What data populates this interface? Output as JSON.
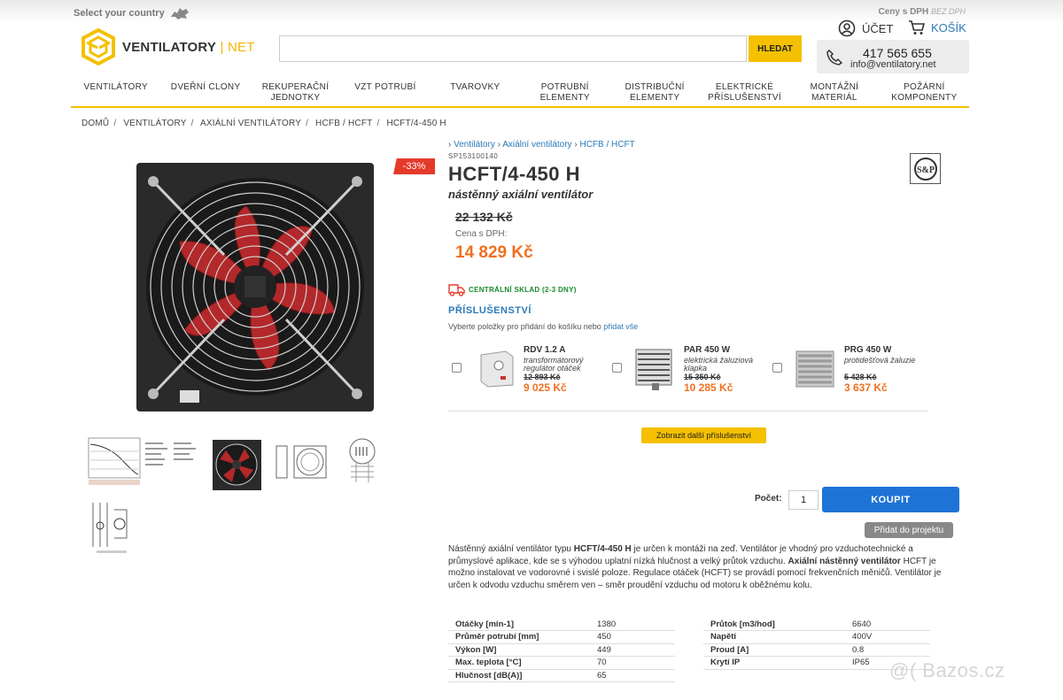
{
  "topbar": {
    "country": "Select your country",
    "vat_label": "Ceny s DPH",
    "vat_alt": "BEZ DPH"
  },
  "logo": {
    "name": "VENTILATORY",
    "suffix": "NET"
  },
  "search": {
    "placeholder": "",
    "button": "HLEDAT"
  },
  "account": {
    "label": "ÚČET"
  },
  "cart": {
    "label": "KOŠÍK"
  },
  "contact": {
    "phone": "417 565 655",
    "email": "info@ventilatory.net"
  },
  "nav": [
    {
      "l1": "VENTILÁTORY",
      "l2": ""
    },
    {
      "l1": "DVEŘNÍ CLONY",
      "l2": ""
    },
    {
      "l1": "REKUPERAČNÍ",
      "l2": "JEDNOTKY"
    },
    {
      "l1": "VZT POTRUBÍ",
      "l2": ""
    },
    {
      "l1": "TVAROVKY",
      "l2": ""
    },
    {
      "l1": "POTRUBNÍ",
      "l2": "ELEMENTY"
    },
    {
      "l1": "DISTRIBUČNÍ",
      "l2": "ELEMENTY"
    },
    {
      "l1": "ELEKTRICKÉ",
      "l2": "PŘÍSLUŠENSTVÍ"
    },
    {
      "l1": "MONTÁŽNÍ",
      "l2": "MATERIÁL"
    },
    {
      "l1": "POŽÁRNÍ",
      "l2": "KOMPONENTY"
    }
  ],
  "breadcrumb": [
    "DOMŮ",
    "VENTILÁTORY",
    "AXIÁLNÍ VENTILÁTORY",
    "HCFB / HCFT",
    "HCFT/4-450 H"
  ],
  "product": {
    "crumb": [
      "Ventilátory",
      "Axiální ventilátory",
      "HCFB / HCFT"
    ],
    "sku": "SP153100140",
    "title": "HCFT/4-450 H",
    "subtitle": "nástěnný axiální ventilátor",
    "discount": "-33%",
    "old_price": "22 132 Kč",
    "price_label": "Cena s DPH:",
    "price": "14 829 Kč",
    "stock": "CENTRÁLNÍ SKLAD (2-3 DNY)"
  },
  "accessories": {
    "title": "PŘÍSLUŠENSTVÍ",
    "note": "Vyberte položky pro přidání do košíku nebo ",
    "note_link": "přidat vše",
    "items": [
      {
        "name": "RDV 1.2 A",
        "desc1": "transformátorový",
        "desc2": "regulátor otáček",
        "old": "12 893 Kč",
        "price": "9 025 Kč"
      },
      {
        "name": "PAR 450 W",
        "desc1": "elektrická žaluziová",
        "desc2": "klapka",
        "old": "15 350 Kč",
        "price": "10 285 Kč"
      },
      {
        "name": "PRG 450 W",
        "desc1": "protidešťová žaluzie",
        "desc2": "",
        "old": "5 428 Kč",
        "price": "3 637 Kč"
      }
    ],
    "more": "Zobrazit další příslušenství"
  },
  "buy": {
    "qty_label": "Počet:",
    "qty": "1",
    "button": "KOUPIT",
    "project": "Přidat do projektu"
  },
  "description": {
    "p1": "Nástěnný axiální ventilátor typu ",
    "b1": "HCFT/4-450 H",
    "p2": " je určen k montáži na zeď. Ventilátor je vhodný pro vzduchotechnické a průmyslové aplikace, kde se s výhodou uplatní nízká hlučnost a velký průtok vzduchu. ",
    "b2": "Axiální nástěnný ventilátor",
    "p3": " HCFT je možno instalovat ve vodorovné i svislé poloze. Regulace otáček (HCFT) se provádí pomocí frekvenčních měničů. Ventilátor je určen k odvodu vzduchu směrem ven – směr proudění vzduchu od motoru k oběžnému kolu."
  },
  "specs_left": [
    {
      "k": "Otáčky [min-1]",
      "v": "1380"
    },
    {
      "k": "Průměr potrubí [mm]",
      "v": "450"
    },
    {
      "k": "Výkon [W]",
      "v": "449"
    },
    {
      "k": "Max. teplota [°C]",
      "v": "70"
    },
    {
      "k": "Hlučnost [dB(A)]",
      "v": "65"
    }
  ],
  "specs_right": [
    {
      "k": "Průtok [m3/hod]",
      "v": "6640"
    },
    {
      "k": "Napětí",
      "v": "400V"
    },
    {
      "k": "Proud [A]",
      "v": "0.8"
    },
    {
      "k": "Krytí IP",
      "v": "IP65"
    }
  ],
  "watermark": "@( Bazos.cz"
}
